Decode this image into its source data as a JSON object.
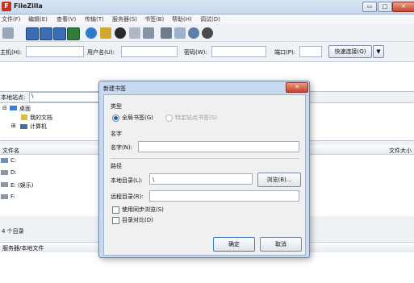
{
  "app": {
    "title": "FileZilla",
    "logo_letter": "F"
  },
  "window_controls": {
    "minimize": "▭",
    "maximize": "□",
    "close": "✕"
  },
  "menu": [
    "文件(F)",
    "编辑(E)",
    "查看(V)",
    "传输(T)",
    "服务器(S)",
    "书签(B)",
    "帮助(H)",
    "调试(D)"
  ],
  "quickconnect": {
    "host_label": "主机(H):",
    "host_value": "",
    "user_label": "用户名(U):",
    "user_value": "",
    "pass_label": "密码(W):",
    "pass_value": "",
    "port_label": "端口(P):",
    "port_value": "",
    "connect_label": "快速连接(Q)",
    "dropdown_glyph": "▼"
  },
  "local": {
    "site_label": "本地站点:",
    "site_path": "\\",
    "tree": [
      {
        "label": "桌面",
        "expander": "⊟"
      },
      {
        "label": "我的文档",
        "expander": ""
      },
      {
        "label": "计算机",
        "expander": "⊞"
      }
    ],
    "columns": {
      "name": "文件名",
      "size": "文件大小"
    },
    "files": [
      "C:",
      "D:",
      "E: (娱乐)",
      "F:"
    ],
    "status": "4 个目录"
  },
  "queue": {
    "header": "服务器/本地文件"
  },
  "dialog": {
    "title": "新建书签",
    "close": "✕",
    "type_section": "类型",
    "type_global": "全局书签(G)",
    "type_site": "特定站点书签(S)",
    "name_section": "名字",
    "name_label": "名字(N):",
    "name_value": "",
    "path_section": "路径",
    "local_dir_label": "本地目录(L):",
    "local_dir_value": "\\",
    "browse": "浏览(B)...",
    "remote_dir_label": "远程目录(R):",
    "remote_dir_value": "",
    "sync_browse": "使用同步浏览(S)",
    "dir_compare": "目录对比(D)",
    "ok": "确定",
    "cancel": "取消"
  }
}
